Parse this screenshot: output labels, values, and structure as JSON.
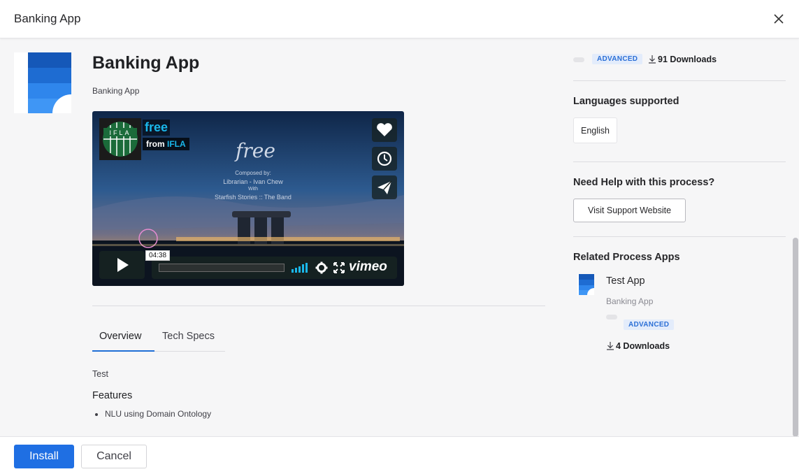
{
  "dialog": {
    "title": "Banking App"
  },
  "app": {
    "name": "Banking App",
    "subtitle": "Banking App",
    "level_badge": "ADVANCED",
    "downloads": "91 Downloads"
  },
  "video": {
    "title": "free",
    "from_prefix": "from",
    "from_org": "IFLA",
    "badge_text": "IFLA",
    "script_title": "free",
    "credit_lines": [
      "Composed by:",
      "Librarian - Ivan Chew",
      "With",
      "Starfish Stories :: The Band"
    ],
    "timestamp": "04:38",
    "provider": "vimeo",
    "progress": 0
  },
  "tabs": [
    {
      "label": "Overview",
      "active": true
    },
    {
      "label": "Tech Specs",
      "active": false
    }
  ],
  "overview": {
    "text": "Test",
    "features_title": "Features",
    "features": [
      "NLU using Domain Ontology"
    ]
  },
  "sidebar": {
    "languages_title": "Languages supported",
    "languages": [
      "English"
    ],
    "help_title": "Need Help with this process?",
    "support_button": "Visit Support Website",
    "related_title": "Related Process Apps",
    "related": [
      {
        "name": "Test App",
        "subtitle": "Banking App",
        "badge": "ADVANCED",
        "downloads": "4 Downloads"
      }
    ]
  },
  "footer": {
    "install_label": "Install",
    "cancel_label": "Cancel"
  },
  "colors": {
    "accent": "#1f6fe3",
    "badge_bg": "#e3ecfb",
    "vimeo_blue": "#1ab7ea"
  }
}
